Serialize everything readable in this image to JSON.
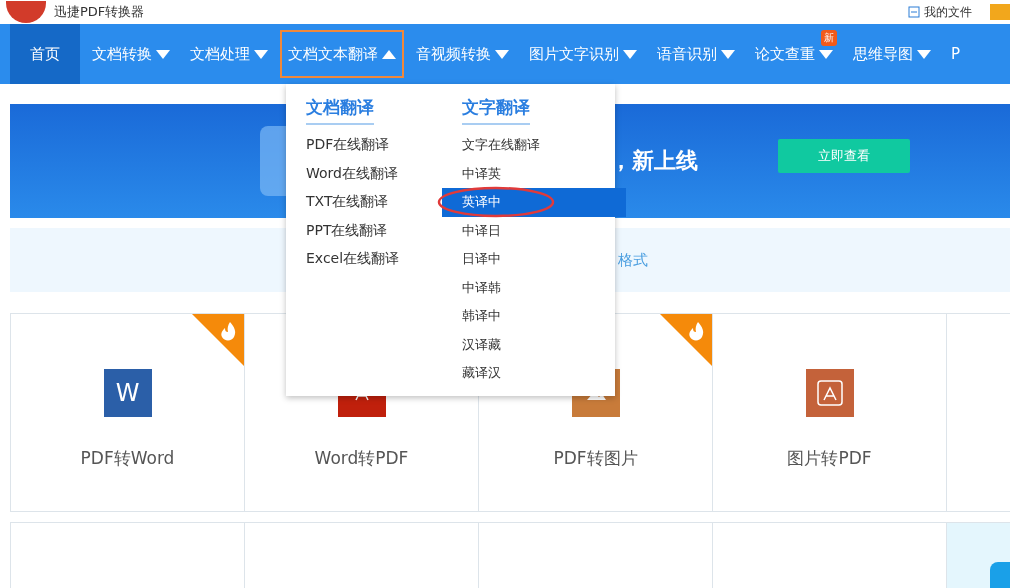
{
  "header": {
    "app_name": "迅捷PDF转换器",
    "my_files": "我的文件"
  },
  "nav": [
    {
      "label": "首页",
      "kind": "home",
      "selected": false,
      "caret": false
    },
    {
      "label": "文档转换",
      "kind": "menu",
      "selected": false,
      "caret": true
    },
    {
      "label": "文档处理",
      "kind": "menu",
      "selected": false,
      "caret": true
    },
    {
      "label": "文档文本翻译",
      "kind": "menu",
      "selected": true,
      "caret": true
    },
    {
      "label": "音视频转换",
      "kind": "menu",
      "selected": false,
      "caret": true
    },
    {
      "label": "图片文字识别",
      "kind": "menu",
      "selected": false,
      "caret": true
    },
    {
      "label": "语音识别",
      "kind": "menu",
      "selected": false,
      "caret": true
    },
    {
      "label": "论文查重",
      "kind": "menu",
      "selected": false,
      "caret": true,
      "badge": "新"
    },
    {
      "label": "思维导图",
      "kind": "menu",
      "selected": false,
      "caret": true
    },
    {
      "label": "P",
      "kind": "menu",
      "selected": false,
      "caret": false
    }
  ],
  "dropdown": {
    "columns": [
      {
        "heading": "文档翻译",
        "items": [
          {
            "label": "PDF在线翻译",
            "selected": false
          },
          {
            "label": "Word在线翻译",
            "selected": false
          },
          {
            "label": "TXT在线翻译",
            "selected": false
          },
          {
            "label": "PPT在线翻译",
            "selected": false
          },
          {
            "label": "Excel在线翻译",
            "selected": false
          }
        ]
      },
      {
        "heading": "文字翻译",
        "items": [
          {
            "label": "文字在线翻译",
            "selected": false
          },
          {
            "label": "中译英",
            "selected": false
          },
          {
            "label": "英译中",
            "selected": true
          },
          {
            "label": "中译日",
            "selected": false
          },
          {
            "label": "日译中",
            "selected": false
          },
          {
            "label": "中译韩",
            "selected": false
          },
          {
            "label": "韩译中",
            "selected": false
          },
          {
            "label": "汉译藏",
            "selected": false
          },
          {
            "label": "藏译汉",
            "selected": false
          }
        ]
      }
    ]
  },
  "banner": {
    "headline": "，新上线",
    "button": "立即查看"
  },
  "info_bar": {
    "text": "格式"
  },
  "tools": [
    {
      "title": "PDF转Word",
      "icon_letter": "W",
      "hot": true
    },
    {
      "title": "Word转PDF",
      "hot": false
    },
    {
      "title": "PDF转图片",
      "hot": true
    },
    {
      "title": "图片转PDF",
      "hot": false
    }
  ]
}
